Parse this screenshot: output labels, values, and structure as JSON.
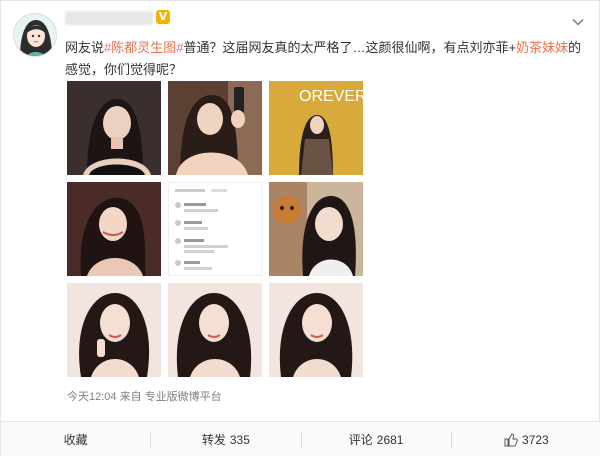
{
  "post": {
    "author_badge": "V",
    "text": {
      "t1": "网友说",
      "tag1": "#陈都灵生图#",
      "t2": "普通？这届网友真的太严格了…这颜很仙啊，有点刘亦菲+",
      "tag2": "奶茶妹妹",
      "t3": "的感觉，你们觉得呢？"
    },
    "images": [
      {
        "icon": "photo-portrait"
      },
      {
        "icon": "photo-portrait"
      },
      {
        "icon": "photo-event"
      },
      {
        "icon": "photo-portrait"
      },
      {
        "icon": "photo-comment-screenshot"
      },
      {
        "icon": "photo-portrait"
      },
      {
        "icon": "photo-portrait"
      },
      {
        "icon": "photo-portrait"
      },
      {
        "icon": "photo-portrait"
      }
    ],
    "event_backdrop_text": "OREVER",
    "meta": {
      "time": "今天12:04",
      "via": "来自",
      "source": "专业版微博平台"
    }
  },
  "actions": {
    "favorite": {
      "label": "收藏"
    },
    "repost": {
      "label": "转发",
      "count": "335"
    },
    "comment": {
      "label": "评论",
      "count": "2681"
    },
    "like": {
      "count": "3723"
    }
  },
  "colors": {
    "tag": "#eb7350",
    "badge": "#f2b200",
    "meta": "#808080"
  }
}
